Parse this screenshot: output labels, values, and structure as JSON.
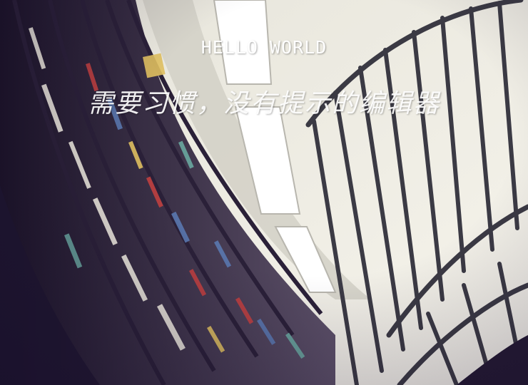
{
  "banner": {
    "title": "HELLO WORLD",
    "subtitle": "需要习惯，没有提示的编辑器"
  },
  "scene": {
    "description_icon": "library-bookshelf-photo",
    "colors": {
      "shadow": "#1f1630",
      "shelf_wood": "#4a3a5a",
      "ceiling": "#f4f2e8",
      "light_panel": "#ffffff",
      "railing": "#3b3a44",
      "book_red": "#c04040",
      "book_blue": "#5a78b0",
      "book_yellow": "#e0c060",
      "book_teal": "#6aa8a0"
    }
  }
}
